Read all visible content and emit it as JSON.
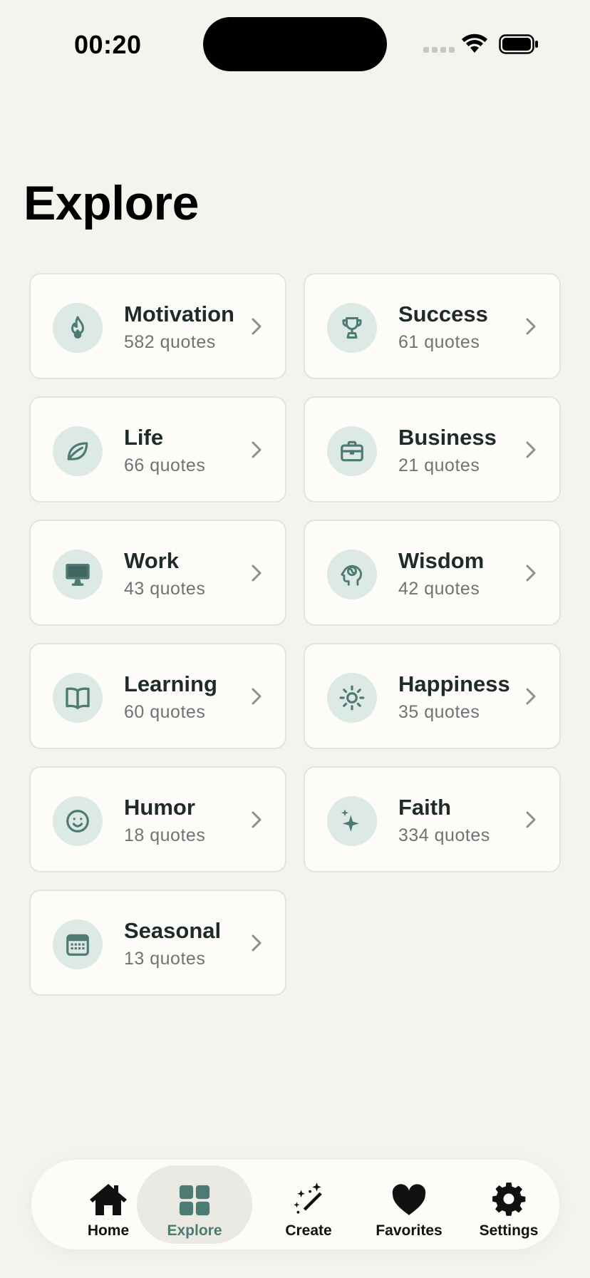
{
  "status_bar": {
    "time": "00:20"
  },
  "title": "Explore",
  "categories": [
    {
      "name": "Motivation",
      "count": "582 quotes",
      "icon": "flame-icon"
    },
    {
      "name": "Success",
      "count": "61 quotes",
      "icon": "trophy-icon"
    },
    {
      "name": "Life",
      "count": "66 quotes",
      "icon": "leaf-icon"
    },
    {
      "name": "Business",
      "count": "21 quotes",
      "icon": "briefcase-icon"
    },
    {
      "name": "Work",
      "count": "43 quotes",
      "icon": "monitor-icon"
    },
    {
      "name": "Wisdom",
      "count": "42 quotes",
      "icon": "brain-head-icon"
    },
    {
      "name": "Learning",
      "count": "60 quotes",
      "icon": "book-icon"
    },
    {
      "name": "Happiness",
      "count": "35 quotes",
      "icon": "sun-icon"
    },
    {
      "name": "Humor",
      "count": "18 quotes",
      "icon": "smiley-icon"
    },
    {
      "name": "Faith",
      "count": "334 quotes",
      "icon": "sparkle-icon"
    },
    {
      "name": "Seasonal",
      "count": "13 quotes",
      "icon": "calendar-icon"
    }
  ],
  "tabs": [
    {
      "label": "Home",
      "icon": "house-icon"
    },
    {
      "label": "Explore",
      "icon": "grid-icon",
      "active": true
    },
    {
      "label": "Create",
      "icon": "magic-wand-icon"
    },
    {
      "label": "Favorites",
      "icon": "heart-icon"
    },
    {
      "label": "Settings",
      "icon": "gear-icon"
    }
  ],
  "colors": {
    "background": "#f5f3ee",
    "card": "#fdfcf8",
    "accent": "#4d7a72",
    "icon_bg": "#dde9e5",
    "text": "#1f2a2a",
    "muted": "#6f7473"
  }
}
